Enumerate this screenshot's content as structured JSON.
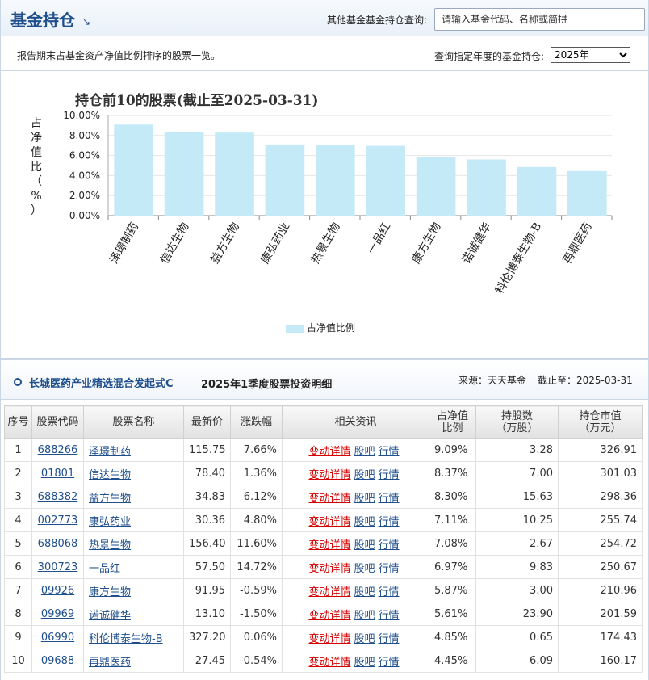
{
  "header": {
    "title": "基金持仓",
    "query_label": "其他基金基金持仓查询:",
    "query_placeholder": "请输入基金代码、名称或简拼"
  },
  "subheader": {
    "description": "报告期末占基金资产净值比例排序的股票一览。",
    "year_label": "查询指定年度的基金持仓:",
    "year_selected": "2025年"
  },
  "chart_data": {
    "type": "bar",
    "title": "持仓前10的股票(截止至2025-03-31)",
    "ylabel": "占净值比（%）",
    "ylabel_chars": [
      "占",
      "净",
      "值",
      "比",
      "（",
      "%",
      "）"
    ],
    "ylim": [
      0,
      10
    ],
    "yticks": [
      "0.00%",
      "2.00%",
      "4.00%",
      "6.00%",
      "8.00%",
      "10.00%"
    ],
    "categories": [
      "泽璟制药",
      "信达生物",
      "益方生物",
      "康弘药业",
      "热景生物",
      "一品红",
      "康方生物",
      "诺诚健华",
      "科伦博泰生物-B",
      "再鼎医药"
    ],
    "values": [
      9.09,
      8.37,
      8.3,
      7.11,
      7.08,
      6.97,
      5.87,
      5.61,
      4.85,
      4.45
    ],
    "bar_color": "#c4eaf7",
    "grid": true,
    "legend": {
      "label": "占净值比例",
      "placement": "bottom"
    }
  },
  "section": {
    "fund_name": "长城医药产业精选混合发起式C",
    "period": "2025年1季度股票投资明细",
    "source": "来源：天天基金",
    "deadline": "截止至：2025-03-31"
  },
  "table": {
    "headers": [
      "序号",
      "股票代码",
      "股票名称",
      "最新价",
      "涨跌幅",
      "相关资讯",
      "占净值\n比例",
      "持股数\n（万股）",
      "持仓市值\n（万元）"
    ],
    "header_lines": {
      "ratio": [
        "占净值",
        "比例"
      ],
      "shares": [
        "持股数",
        "（万股）"
      ],
      "value": [
        "持仓市值",
        "（万元）"
      ]
    },
    "links": [
      "变动详情",
      "股吧",
      "行情"
    ],
    "rows": [
      {
        "no": "1",
        "code": "688266",
        "name": "泽璟制药",
        "price": "115.75",
        "change": "7.66%",
        "dir": "up",
        "ratio": "9.09%",
        "shares": "3.28",
        "value": "326.91"
      },
      {
        "no": "2",
        "code": "01801",
        "name": "信达生物",
        "price": "78.40",
        "change": "1.36%",
        "dir": "up",
        "ratio": "8.37%",
        "shares": "7.00",
        "value": "301.03"
      },
      {
        "no": "3",
        "code": "688382",
        "name": "益方生物",
        "price": "34.83",
        "change": "6.12%",
        "dir": "up",
        "ratio": "8.30%",
        "shares": "15.63",
        "value": "298.36"
      },
      {
        "no": "4",
        "code": "002773",
        "name": "康弘药业",
        "price": "30.36",
        "change": "4.80%",
        "dir": "up",
        "ratio": "7.11%",
        "shares": "10.25",
        "value": "255.74"
      },
      {
        "no": "5",
        "code": "688068",
        "name": "热景生物",
        "price": "156.40",
        "change": "11.60%",
        "dir": "up",
        "ratio": "7.08%",
        "shares": "2.67",
        "value": "254.72"
      },
      {
        "no": "6",
        "code": "300723",
        "name": "一品红",
        "price": "57.50",
        "change": "14.72%",
        "dir": "up",
        "ratio": "6.97%",
        "shares": "9.83",
        "value": "250.67"
      },
      {
        "no": "7",
        "code": "09926",
        "name": "康方生物",
        "price": "91.95",
        "change": "-0.59%",
        "dir": "down",
        "ratio": "5.87%",
        "shares": "3.00",
        "value": "210.96"
      },
      {
        "no": "8",
        "code": "09969",
        "name": "诺诚健华",
        "price": "13.10",
        "change": "-1.50%",
        "dir": "down",
        "ratio": "5.61%",
        "shares": "23.90",
        "value": "201.59"
      },
      {
        "no": "9",
        "code": "06990",
        "name": "科伦博泰生物-B",
        "price": "327.20",
        "change": "0.06%",
        "dir": "up",
        "ratio": "4.85%",
        "shares": "0.65",
        "value": "174.43"
      },
      {
        "no": "10",
        "code": "09688",
        "name": "再鼎医药",
        "price": "27.45",
        "change": "-0.54%",
        "dir": "down",
        "ratio": "4.45%",
        "shares": "6.09",
        "value": "160.17"
      }
    ]
  },
  "colors": {
    "brand": "#1f4f8c",
    "up": "#d40000",
    "down": "#008c00",
    "bar": "#c4eaf7"
  }
}
